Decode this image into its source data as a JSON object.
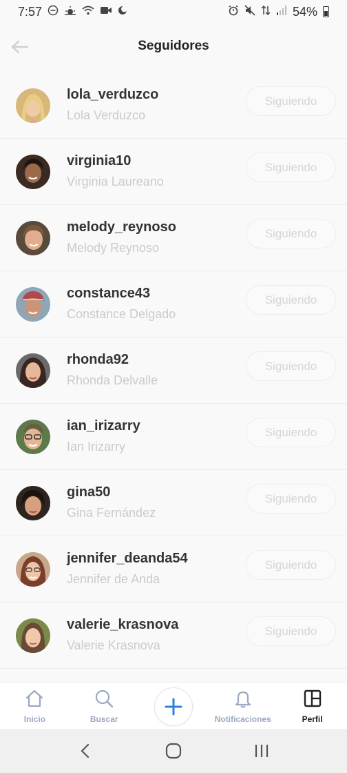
{
  "status_bar": {
    "time": "7:57",
    "battery_percent": "54%",
    "left_icons": [
      "do-not-disturb-icon",
      "weather-icon",
      "wifi-calling-icon",
      "video-icon",
      "moon-icon"
    ],
    "right_icons": [
      "alarm-icon",
      "mute-icon",
      "data-icon",
      "signal-icon",
      "battery-icon"
    ]
  },
  "header": {
    "title": "Seguidores",
    "back_icon": "arrow-left-icon"
  },
  "followers": [
    {
      "username": "lola_verduzco",
      "name": "Lola Verduzco",
      "button": "Siguiendo"
    },
    {
      "username": "virginia10",
      "name": "Virginia Laureano",
      "button": "Siguiendo"
    },
    {
      "username": "melody_reynoso",
      "name": "Melody Reynoso",
      "button": "Siguiendo"
    },
    {
      "username": "constance43",
      "name": "Constance Delgado",
      "button": "Siguiendo"
    },
    {
      "username": "rhonda92",
      "name": "Rhonda Delvalle",
      "button": "Siguiendo"
    },
    {
      "username": "ian_irizarry",
      "name": "Ian Irizarry",
      "button": "Siguiendo"
    },
    {
      "username": "gina50",
      "name": "Gina Fernández",
      "button": "Siguiendo"
    },
    {
      "username": "jennifer_deanda54",
      "name": "Jennifer de Anda",
      "button": "Siguiendo"
    },
    {
      "username": "valerie_krasnova",
      "name": "Valerie Krasnova",
      "button": "Siguiendo"
    }
  ],
  "bottom_nav": {
    "items": [
      {
        "label": "Inicio",
        "icon": "home-icon"
      },
      {
        "label": "Buscar",
        "icon": "search-icon"
      },
      {
        "label": "Notificaciones",
        "icon": "bell-icon"
      },
      {
        "label": "Perfil",
        "icon": "profile-grid-icon"
      }
    ],
    "add_icon": "plus-icon",
    "active": "Perfil"
  },
  "colors": {
    "accent": "#2f7fd8",
    "inactive_nav": "#9aa8c0",
    "muted_text": "#cbcbcb"
  }
}
